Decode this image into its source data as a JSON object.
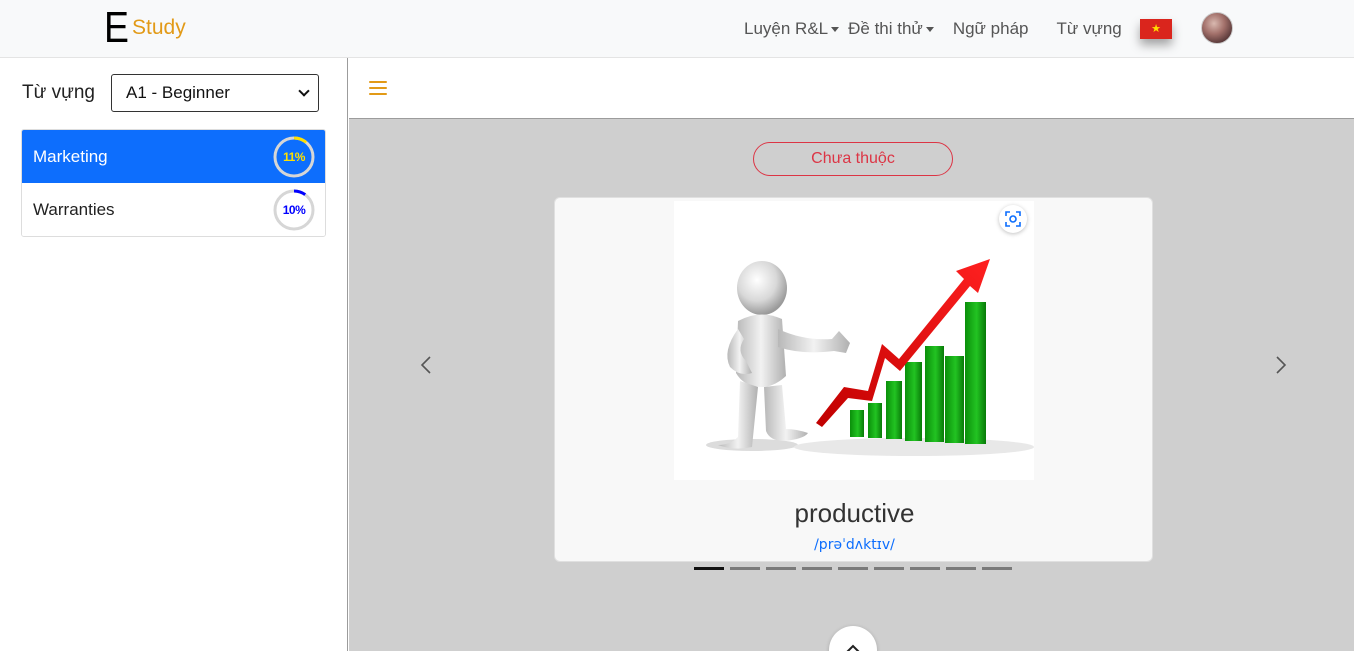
{
  "navbar": {
    "logo_e": "E",
    "logo_study": "Study",
    "links": [
      {
        "label": "Luyện R&L",
        "dropdown": true
      },
      {
        "label": "Đề thi thử",
        "dropdown": true
      },
      {
        "label": "Ngữ pháp",
        "dropdown": false
      },
      {
        "label": "Từ vựng",
        "dropdown": false
      }
    ],
    "flag_icon": "vietnam-flag-icon",
    "flag_star": "★",
    "avatar_icon": "user-avatar"
  },
  "sidebar": {
    "title": "Từ vựng",
    "level_select": {
      "selected": "A1 - Beginner"
    },
    "topics": [
      {
        "label": "Marketing",
        "progress_label": "11%",
        "progress": 0.11,
        "active": true,
        "ring_color": "#ffe000"
      },
      {
        "label": "Warranties",
        "progress_label": "10%",
        "progress": 0.1,
        "active": false,
        "ring_color": "#0000ff"
      }
    ]
  },
  "main": {
    "menu_icon": "hamburger-icon",
    "status_label": "Chưa thuộc",
    "card": {
      "word": "productive",
      "ipa": "/prəˈdʌktɪv/",
      "image_icon": "growth-chart-illustration",
      "zoom_icon": "focus-zoom-icon"
    },
    "prev_icon": "chevron-left-icon",
    "next_icon": "chevron-right-icon",
    "slides": {
      "total": 9,
      "current": 1
    },
    "scroll_top_icon": "chevron-up-icon"
  },
  "colors": {
    "brand": "#e29a17",
    "primary": "#0d6efd",
    "danger": "#dc3545",
    "content_bg": "#cfcfcf"
  }
}
